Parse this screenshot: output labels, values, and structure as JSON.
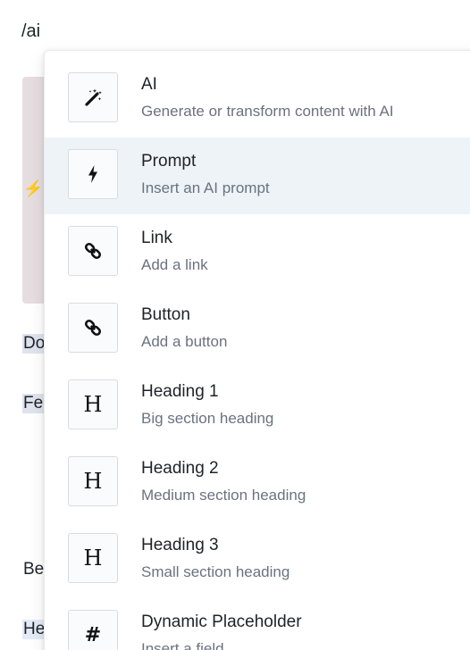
{
  "editor": {
    "slash_query": "/ai",
    "fragments": [
      "Do",
      "Fe",
      "Be",
      "He"
    ]
  },
  "menu": {
    "items": [
      {
        "title": "AI",
        "description": "Generate or transform content with AI",
        "icon": "magic-wand-icon"
      },
      {
        "title": "Prompt",
        "description": "Insert an AI prompt",
        "icon": "lightning-bolt-icon",
        "active": true
      },
      {
        "title": "Link",
        "description": "Add a link",
        "icon": "link-icon"
      },
      {
        "title": "Button",
        "description": "Add a button",
        "icon": "link-icon"
      },
      {
        "title": "Heading 1",
        "description": "Big section heading",
        "icon": "heading-icon",
        "glyph": "H"
      },
      {
        "title": "Heading 2",
        "description": "Medium section heading",
        "icon": "heading-icon",
        "glyph": "H"
      },
      {
        "title": "Heading 3",
        "description": "Small section heading",
        "icon": "heading-icon",
        "glyph": "H"
      },
      {
        "title": "Dynamic Placeholder",
        "description": "Insert a field",
        "icon": "hash-icon",
        "glyph": "#"
      }
    ]
  },
  "colors": {
    "active_row": "#eef3f8",
    "title_text": "#1f2328",
    "description_text": "#6b7280"
  }
}
